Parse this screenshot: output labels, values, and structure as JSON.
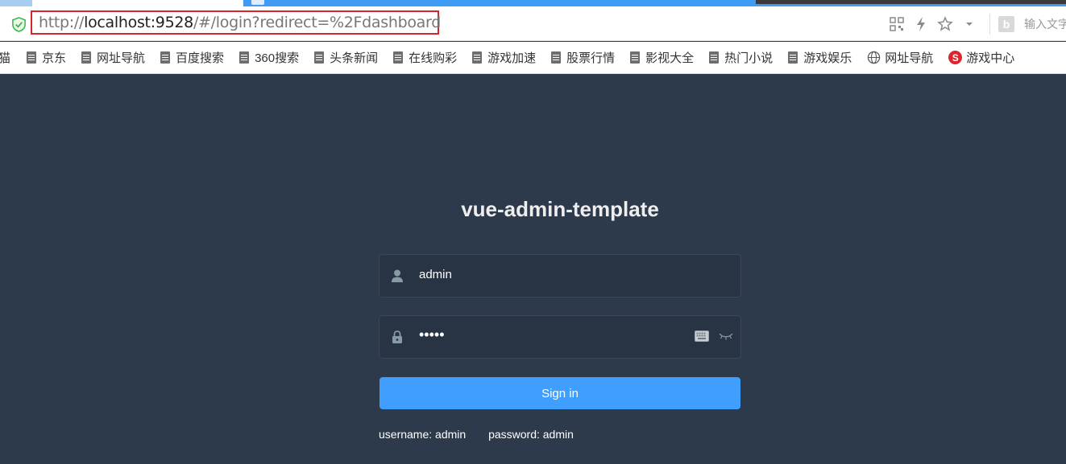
{
  "browser": {
    "url_prefix": "http://",
    "url_host": "localhost:9528",
    "url_path": "/#/login?redirect=%2Fdashboard",
    "search_placeholder": "输入文字",
    "bing_letter": "b"
  },
  "bookmarks": {
    "first_partial": "猫",
    "items": [
      {
        "label": "京东",
        "icon": "doc-icon"
      },
      {
        "label": "网址导航",
        "icon": "doc-icon"
      },
      {
        "label": "百度搜索",
        "icon": "doc-icon"
      },
      {
        "label": "360搜索",
        "icon": "doc-icon"
      },
      {
        "label": "头条新闻",
        "icon": "doc-icon"
      },
      {
        "label": "在线购彩",
        "icon": "doc-icon"
      },
      {
        "label": "游戏加速",
        "icon": "doc-icon"
      },
      {
        "label": "股票行情",
        "icon": "doc-icon"
      },
      {
        "label": "影视大全",
        "icon": "doc-icon"
      },
      {
        "label": "热门小说",
        "icon": "doc-icon"
      },
      {
        "label": "游戏娱乐",
        "icon": "doc-icon"
      },
      {
        "label": "网址导航",
        "icon": "globe-icon"
      },
      {
        "label": "游戏中心",
        "icon": "game-icon"
      }
    ]
  },
  "login": {
    "title": "vue-admin-template",
    "username_value": "admin",
    "password_mask": "•••••",
    "signin_label": "Sign in",
    "tip_username": "username: admin",
    "tip_password": "password: admin"
  },
  "colors": {
    "page_bg": "#2d3a4b",
    "input_bg": "#283443",
    "button": "#409eff",
    "url_highlight": "#d9232a"
  }
}
